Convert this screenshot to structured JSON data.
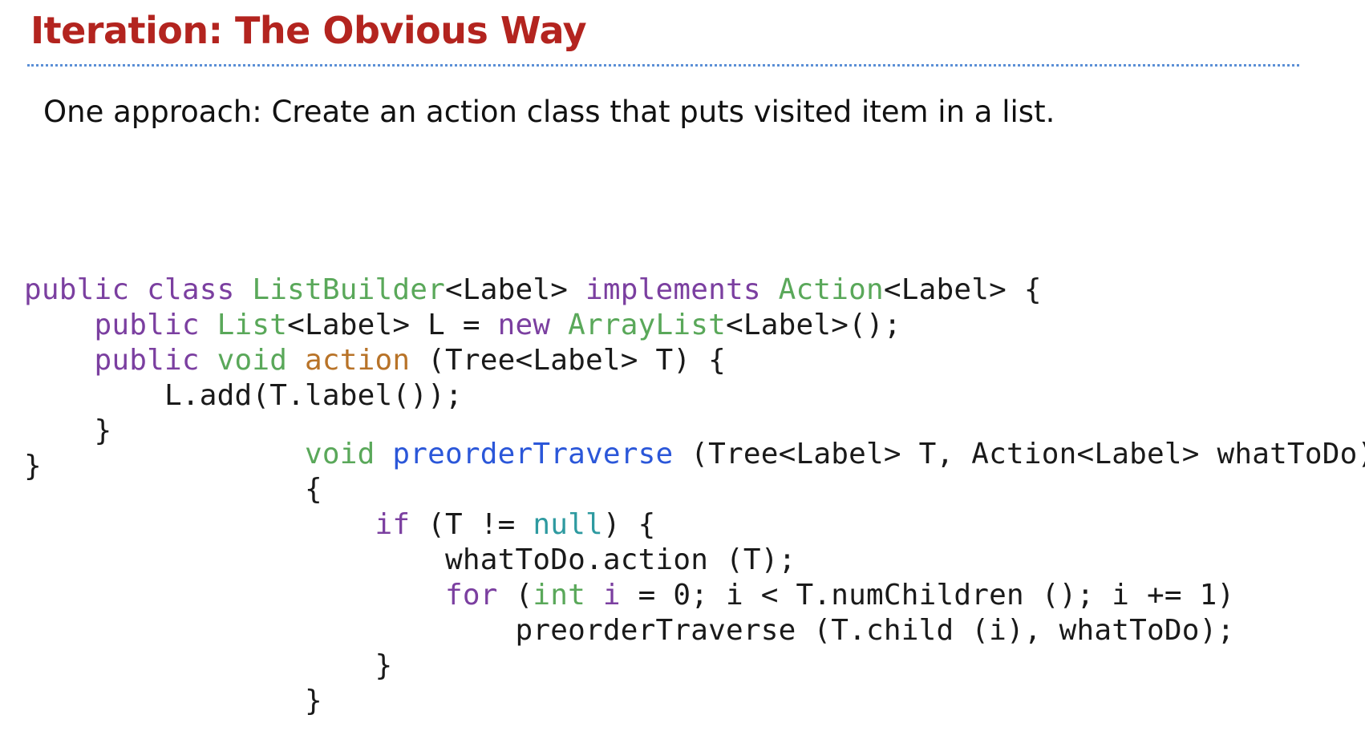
{
  "slide": {
    "title": "Iteration: The Obvious Way",
    "subtitle": "One approach: Create an action class that puts visited item in a list."
  },
  "code_left": [
    [
      {
        "t": "public class ",
        "c": "kw"
      },
      {
        "t": "ListBuilder",
        "c": "ty"
      },
      {
        "t": "<Label> ",
        "c": ""
      },
      {
        "t": "implements ",
        "c": "kw"
      },
      {
        "t": "Action",
        "c": "ty"
      },
      {
        "t": "<Label> {",
        "c": ""
      }
    ],
    [
      {
        "t": "    ",
        "c": ""
      },
      {
        "t": "public ",
        "c": "kw"
      },
      {
        "t": "List",
        "c": "ty"
      },
      {
        "t": "<Label> L = ",
        "c": ""
      },
      {
        "t": "new ",
        "c": "kw"
      },
      {
        "t": "ArrayList",
        "c": "ty"
      },
      {
        "t": "<Label>();",
        "c": ""
      }
    ],
    [
      {
        "t": "    ",
        "c": ""
      },
      {
        "t": "public ",
        "c": "kw"
      },
      {
        "t": "void ",
        "c": "ty"
      },
      {
        "t": "action",
        "c": "mth"
      },
      {
        "t": " (Tree<Label> T) {",
        "c": ""
      }
    ],
    [
      {
        "t": "        L.add(T.label());",
        "c": ""
      }
    ],
    [
      {
        "t": "    }",
        "c": ""
      }
    ],
    [
      {
        "t": "}",
        "c": ""
      }
    ]
  ],
  "code_right": [
    [
      {
        "t": "void ",
        "c": "ty"
      },
      {
        "t": "preorderTraverse",
        "c": "fn"
      },
      {
        "t": " (Tree<Label> T, Action<Label> whatToDo)",
        "c": ""
      }
    ],
    [
      {
        "t": "{",
        "c": ""
      }
    ],
    [
      {
        "t": "    ",
        "c": ""
      },
      {
        "t": "if",
        "c": "kw"
      },
      {
        "t": " (T != ",
        "c": ""
      },
      {
        "t": "null",
        "c": "lit"
      },
      {
        "t": ") {",
        "c": ""
      }
    ],
    [
      {
        "t": "        whatToDo.action (T);",
        "c": ""
      }
    ],
    [
      {
        "t": "        ",
        "c": ""
      },
      {
        "t": "for",
        "c": "kw"
      },
      {
        "t": " (",
        "c": ""
      },
      {
        "t": "int ",
        "c": "ty"
      },
      {
        "t": "i",
        "c": "var"
      },
      {
        "t": " = 0; i < T.numChildren (); i += 1)",
        "c": ""
      }
    ],
    [
      {
        "t": "            preorderTraverse (T.child (i), whatToDo);",
        "c": ""
      }
    ],
    [
      {
        "t": "    }",
        "c": ""
      }
    ],
    [
      {
        "t": "}",
        "c": ""
      }
    ]
  ]
}
